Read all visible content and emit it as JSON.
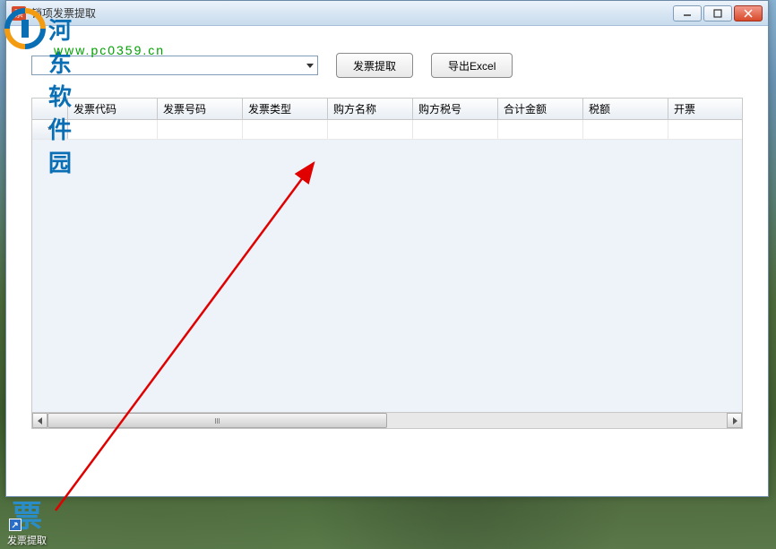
{
  "window": {
    "title": "销项发票提取",
    "icon_glyph": "票"
  },
  "toolbar": {
    "combo_value": "",
    "extract_label": "发票提取",
    "export_label": "导出Excel"
  },
  "grid": {
    "row_indicator": "*",
    "columns": [
      {
        "label": "",
        "width": 40
      },
      {
        "label": "发票代码",
        "width": 100
      },
      {
        "label": "发票号码",
        "width": 95
      },
      {
        "label": "发票类型",
        "width": 95
      },
      {
        "label": "购方名称",
        "width": 95
      },
      {
        "label": "购方税号",
        "width": 95
      },
      {
        "label": "合计金额",
        "width": 95
      },
      {
        "label": "税额",
        "width": 95
      },
      {
        "label": "开票",
        "width": 50
      }
    ],
    "rows": [
      {
        "cells": [
          "",
          "",
          "",
          "",
          "",
          "",
          "",
          ""
        ]
      }
    ]
  },
  "watermark": {
    "brand": "河东软件园",
    "url": "www.pc0359.cn"
  },
  "shortcut": {
    "icon_glyph": "票",
    "label": "发票提取"
  }
}
